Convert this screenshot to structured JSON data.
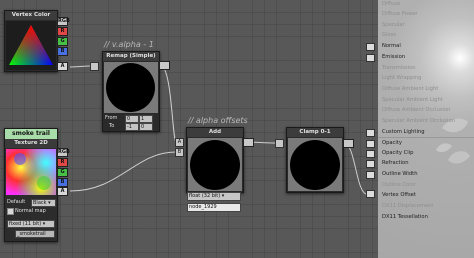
{
  "nodes": {
    "vertex_color": {
      "title": "Vertex Color",
      "ports": [
        "RGB",
        "R",
        "G",
        "B",
        "A"
      ]
    },
    "remap": {
      "title": "Remap (Simple)",
      "comment": "// v.alpha - 1",
      "from_label": "From",
      "to_label": "To",
      "from": [
        "0",
        "1"
      ],
      "to": [
        "-1",
        "0"
      ]
    },
    "add": {
      "title": "Add",
      "comment": "// alpha offsets",
      "inputs": [
        "A",
        "B"
      ],
      "precision": "float (32 bit)",
      "name": "node_1929"
    },
    "clamp": {
      "title": "Clamp 0-1"
    },
    "texture": {
      "header": "smoke trail",
      "title": "Texture 2D",
      "ports": [
        "RGB",
        "R",
        "G",
        "B",
        "A"
      ],
      "default_label": "Default",
      "default_value": "Black",
      "normal_map_label": "Normal map",
      "precision": "fixed (11 bit)",
      "name": "_smoketrail"
    }
  },
  "colors": {
    "port_rgb": "#c8c8c8",
    "port_r": "#e04848",
    "port_g": "#48c048",
    "port_b": "#4870e0",
    "port_a": "#d8d8d8",
    "texture_header": "#a8dca8",
    "wire": "#cfcfcf",
    "canvas": "#585858"
  },
  "panel": {
    "items": [
      {
        "label": "Diffuse",
        "enabled": false
      },
      {
        "label": "Diffuse Power",
        "enabled": false
      },
      {
        "label": "Specular",
        "enabled": false
      },
      {
        "label": "Gloss",
        "enabled": false
      },
      {
        "label": "Normal",
        "enabled": true
      },
      {
        "label": "Emission",
        "enabled": true
      },
      {
        "label": "Transmission",
        "enabled": false
      },
      {
        "label": "Light Wrapping",
        "enabled": false
      },
      {
        "label": "Diffuse Ambient Light",
        "enabled": false
      },
      {
        "label": "Specular Ambient Light",
        "enabled": false
      },
      {
        "label": "Diffuse Ambient Occlusion",
        "enabled": false
      },
      {
        "label": "Specular Ambient Occlusion",
        "enabled": false
      },
      {
        "label": "Custom Lighting",
        "enabled": true
      },
      {
        "label": "Opacity",
        "enabled": true
      },
      {
        "label": "Opacity Clip",
        "enabled": true
      },
      {
        "label": "Refraction",
        "enabled": true
      },
      {
        "label": "Outline Width",
        "enabled": true
      },
      {
        "label": "Outline Color",
        "enabled": false
      },
      {
        "label": "Vertex Offset",
        "enabled": true
      },
      {
        "label": "DX11 Displacement",
        "enabled": false
      }
    ],
    "tessellation": "DX11 Tessellation"
  }
}
